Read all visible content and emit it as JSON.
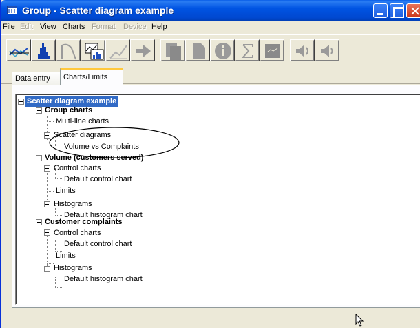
{
  "window": {
    "title": "Group - Scatter diagram example"
  },
  "menu": {
    "items": [
      "File",
      "Edit",
      "View",
      "Charts",
      "Format",
      "Device",
      "Help"
    ]
  },
  "toolbar": {
    "buttons": [
      "multi-line-chart-icon",
      "histogram-icon",
      "curve-icon",
      "scatter-chart-icon",
      "control-chart-icon",
      "arrow-right-icon",
      "documents-icon",
      "document-icon",
      "info-icon",
      "sigma-icon",
      "monitor-icon",
      "speaker-icon",
      "speaker-2-icon"
    ]
  },
  "tabs": {
    "data_entry": "Data entry",
    "charts_limits": "Charts/Limits"
  },
  "tree": {
    "root": "Scatter diagram example",
    "group_charts": "Group charts",
    "multi_line_charts": "Multi-line charts",
    "scatter_diagrams": "Scatter diagrams",
    "volume_vs_complaints": "Volume vs Complaints",
    "volume": "Volume (customers served)",
    "vol_control_charts": "Control charts",
    "vol_default_control_chart": "Default control chart",
    "vol_limits": "Limits",
    "vol_histograms": "Histograms",
    "vol_default_histogram_chart": "Default histogram chart",
    "complaints": "Customer complaints",
    "cc_control_charts": "Control charts",
    "cc_default_control_chart": "Default control chart",
    "cc_limits": "Limits",
    "cc_histograms": "Histograms",
    "cc_default_histogram_chart": "Default histogram chart"
  }
}
